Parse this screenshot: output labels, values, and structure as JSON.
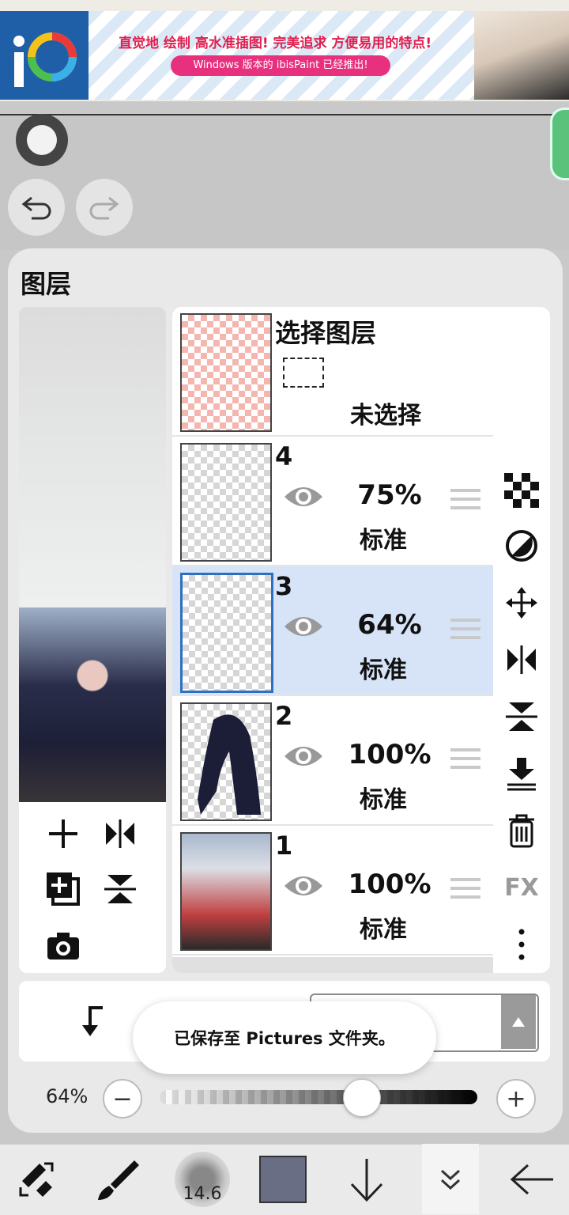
{
  "ad": {
    "logo_text": "iP",
    "headline": "直觉地 绘制 高水准插图! 完美追求 方便易用的特点!",
    "subline": "Windows 版本的 ibisPaint 已经推出!"
  },
  "panel": {
    "title": "图层",
    "selection_layer": {
      "title": "选择图层",
      "status": "未选择"
    },
    "layers": [
      {
        "num": "4",
        "opacity": "75%",
        "mode": "标准",
        "selected": false
      },
      {
        "num": "3",
        "opacity": "64%",
        "mode": "标准",
        "selected": true
      },
      {
        "num": "2",
        "opacity": "100%",
        "mode": "标准",
        "selected": false
      },
      {
        "num": "1",
        "opacity": "100%",
        "mode": "标准",
        "selected": false
      }
    ],
    "side_tools": [
      "checker-icon",
      "half-circle-icon",
      "move-icon",
      "flip-horizontal-icon",
      "flip-vertical-icon",
      "merge-down-icon",
      "trash-icon",
      "fx-icon",
      "more-icon"
    ],
    "fx_label": "FX"
  },
  "toast": "已保存至 Pictures 文件夹。",
  "opacity": {
    "label": "64%",
    "value": 0.64
  },
  "toolbar": {
    "brush_size": "14.6",
    "color": "#6a6e85"
  }
}
